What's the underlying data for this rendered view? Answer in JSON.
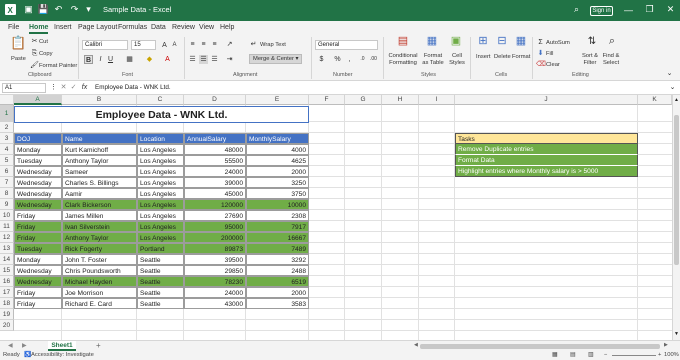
{
  "titlebar": {
    "title": "Sample Data  -  Excel",
    "signin": "Sign in"
  },
  "menu": [
    "File",
    "Home",
    "Insert",
    "Page Layout",
    "Formulas",
    "Data",
    "Review",
    "View",
    "Help"
  ],
  "ribbon": {
    "paste": "Paste",
    "cut": "Cut",
    "copy": "Copy",
    "format_painter": "Format Painter",
    "font_name": "Calibri",
    "font_size": "15",
    "wrap_text": "Wrap Text",
    "merge_center": "Merge & Center",
    "number_format": "General",
    "conditional_formatting": "Conditional Formatting",
    "format_as_table": "Format as Table",
    "cell_styles": "Cell Styles",
    "insert": "Insert",
    "delete": "Delete",
    "format": "Format",
    "autosum": "AutoSum",
    "fill": "Fill",
    "clear": "Clear",
    "sort_filter": "Sort & Filter",
    "find_select": "Find & Select",
    "groups": [
      "Clipboard",
      "Font",
      "Alignment",
      "Number",
      "Styles",
      "Cells",
      "Editing"
    ]
  },
  "formula_bar": {
    "name_box": "A1",
    "fx": "fx",
    "content": "Employee Data - WNK Ltd."
  },
  "columns": [
    "A",
    "B",
    "C",
    "D",
    "E",
    "F",
    "G",
    "H",
    "I",
    "J",
    "K"
  ],
  "rows": [
    "1",
    "2",
    "3",
    "4",
    "5",
    "6",
    "7",
    "8",
    "9",
    "10",
    "11",
    "12",
    "13",
    "14",
    "15",
    "16",
    "17",
    "18",
    "19",
    "20"
  ],
  "sheet": {
    "title": "Employee Data - WNK Ltd.",
    "headers": [
      "DOJ",
      "Name",
      "Location",
      "AnnualSalary",
      "MonthlySalary"
    ],
    "data": [
      [
        "Monday",
        "Kurt Kamichoff",
        "Los Angeles",
        "48000",
        "4000",
        false
      ],
      [
        "Tuesday",
        "Anthony Taylor",
        "Los Angeles",
        "55500",
        "4625",
        false
      ],
      [
        "Wednesday",
        "Sameer",
        "Los Angeles",
        "24000",
        "2000",
        false
      ],
      [
        "Wednesday",
        "Charles S. Billings",
        "Los Angeles",
        "39000",
        "3250",
        false
      ],
      [
        "Wednesday",
        "Aamir",
        "Los Angeles",
        "45000",
        "3750",
        false
      ],
      [
        "Wednesday",
        "Clark Bickerson",
        "Los Angeles",
        "120000",
        "10000",
        true
      ],
      [
        "Friday",
        "James Millen",
        "Los Angeles",
        "27690",
        "2308",
        false
      ],
      [
        "Friday",
        "Ivan Silverstein",
        "Los Angeles",
        "95000",
        "7917",
        true
      ],
      [
        "Friday",
        "Anthony Taylor",
        "Los Angeles",
        "200000",
        "16667",
        true
      ],
      [
        "Tuesday",
        "Rick Fogerty",
        "Portland",
        "89873",
        "7489",
        true
      ],
      [
        "Monday",
        "John T. Foster",
        "Seattle",
        "39500",
        "3292",
        false
      ],
      [
        "Wednesday",
        "Chris Poundsworth",
        "Seattle",
        "29850",
        "2488",
        false
      ],
      [
        "Wednesday",
        "Michael Hayden",
        "Seattle",
        "78230",
        "6519",
        true
      ],
      [
        "Friday",
        "Joe Morrison",
        "Seattle",
        "24000",
        "2000",
        false
      ],
      [
        "Friday",
        "Richard E. Card",
        "Seattle",
        "43000",
        "3583",
        false
      ]
    ]
  },
  "tasks": {
    "header": "Tasks",
    "items": [
      "Remove Duplicate entries",
      "Format Data",
      "Highlight entries where Monthly salary is > 5000"
    ]
  },
  "tabs": {
    "sheet1": "Sheet1"
  },
  "status": {
    "ready": "Ready",
    "accessibility": "Accessibility: Investigate",
    "zoom": "100%"
  },
  "colors": {
    "brand": "#217346",
    "header": "#4472c4",
    "highlight": "#70ad47",
    "task_header": "#ffe699"
  }
}
